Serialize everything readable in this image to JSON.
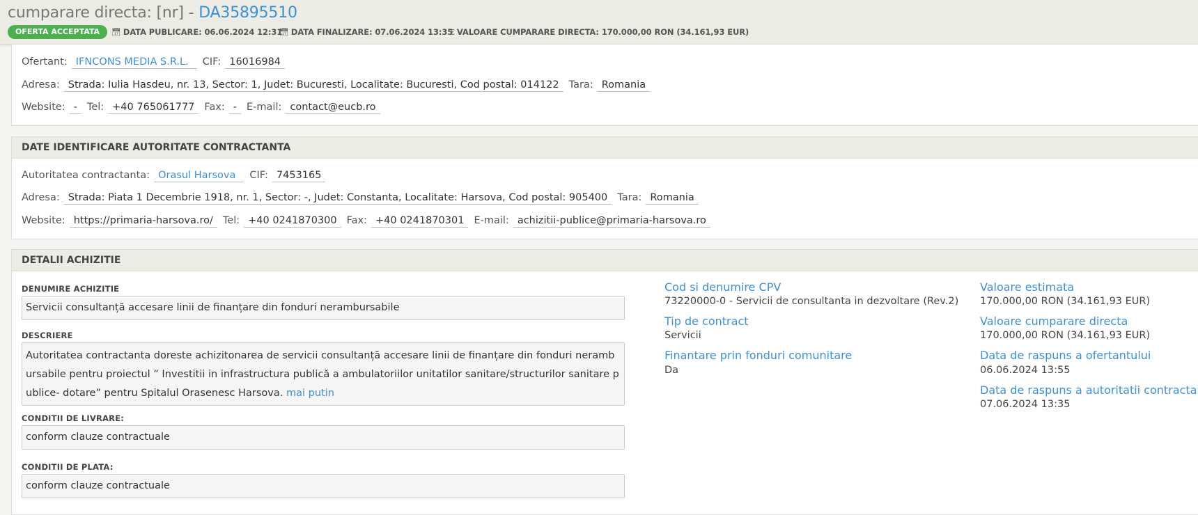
{
  "header": {
    "title_prefix": "cumparare directa: [nr] - ",
    "code": "DA35895510",
    "status_badge": "OFERTA ACCEPTATA",
    "data_publicare": "DATA PUBLICARE: 06.06.2024 12:31",
    "data_finalizare": "DATA FINALIZARE: 07.06.2024 13:35",
    "valoare": "VALOARE CUMPARARE DIRECTA: 170.000,00  RON (34.161,93  EUR)",
    "icons": {
      "calendar": "calendar-icon",
      "euro": "euro-icon"
    }
  },
  "ofertant": {
    "label": "Ofertant:",
    "name": "IFNCONS MEDIA S.R.L.",
    "cif_label": "CIF:",
    "cif": "16016984",
    "adresa_label": "Adresa:",
    "adresa": "Strada: Iulia Hasdeu, nr. 13, Sector: 1, Judet: Bucuresti, Localitate: Bucuresti, Cod postal: 014122",
    "tara_label": "Tara:",
    "tara": "Romania",
    "website_label": "Website:",
    "website": "-",
    "tel_label": "Tel:",
    "tel": "+40 765061777",
    "fax_label": "Fax:",
    "fax": "-",
    "email_label": "E-mail:",
    "email": "contact@eucb.ro"
  },
  "autoritate": {
    "section_title": "DATE IDENTIFICARE AUTORITATE CONTRACTANTA",
    "label": "Autoritatea contractanta:",
    "name": "Orasul Harsova",
    "cif_label": "CIF:",
    "cif": "7453165",
    "adresa_label": "Adresa:",
    "adresa": "Strada: Piata 1 Decembrie 1918, nr. 1, Sector: -, Judet: Constanta, Localitate: Harsova, Cod postal: 905400",
    "tara_label": "Tara:",
    "tara": "Romania",
    "website_label": "Website:",
    "website": "https://primaria-harsova.ro/",
    "tel_label": "Tel:",
    "tel": "+40 0241870300",
    "fax_label": "Fax:",
    "fax": "+40 0241870301",
    "email_label": "E-mail:",
    "email": "achizitii-publice@primaria-harsova.ro"
  },
  "detalii": {
    "section_title": "DETALII ACHIZITIE",
    "denumire_label": "DENUMIRE ACHIZITIE",
    "denumire": "Servicii consultanță accesare linii de finanțare din fonduri nerambursabile",
    "descriere_label": "DESCRIERE",
    "descriere": "Autoritatea contractanta doreste achizitonarea de servicii consultanță accesare linii de finanțare din fonduri nerambursabile pentru proiectul ” Investitii in infrastructura publică a ambulatoriilor unitatilor sanitare/structurilor sanitare publice- dotare” pentru Spitalul Orasenesc Harsova.",
    "mai_putin": "mai putin",
    "livrare_label": "CONDITII DE LIVRARE:",
    "livrare": "conform clauze contractuale",
    "plata_label": "CONDITII DE PLATA:",
    "plata": "conform clauze contractuale",
    "cpv_title": "Cod si denumire CPV",
    "cpv": "73220000-0 - Servicii de consultanta in dezvoltare (Rev.2)",
    "tip_title": "Tip de contract",
    "tip": "Servicii",
    "finantare_title": "Finantare prin fonduri comunitare",
    "finantare": "Da",
    "val_est_title": "Valoare estimata",
    "val_est": "170.000,00  RON (34.161,93  EUR)",
    "val_cd_title": "Valoare cumparare directa",
    "val_cd": "170.000,00  RON (34.161,93  EUR)",
    "raspuns_of_title": "Data de raspuns a ofertantului",
    "raspuns_of": "06.06.2024 13:55",
    "raspuns_ac_title": "Data de raspuns a autoritatii contractante",
    "raspuns_ac": "07.06.2024 13:35"
  }
}
